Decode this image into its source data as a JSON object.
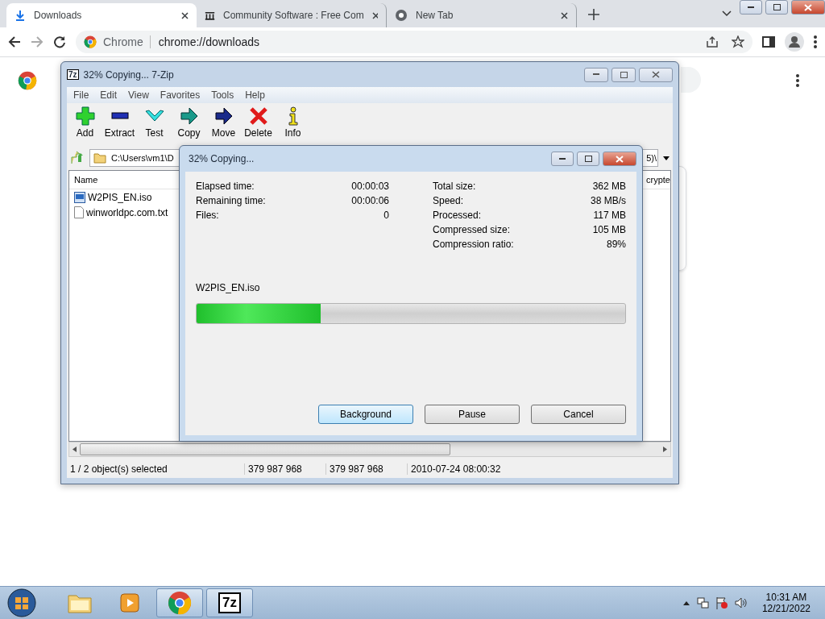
{
  "browser": {
    "tabs": [
      {
        "title": "Downloads",
        "kind": "download",
        "selected": true
      },
      {
        "title": "Community Software : Free Com",
        "kind": "archive",
        "selected": false
      },
      {
        "title": "New Tab",
        "kind": "chrome",
        "selected": false
      }
    ],
    "address": {
      "site": "Chrome",
      "url": "chrome://downloads"
    }
  },
  "zip_window": {
    "logo": "7z",
    "title": "32% Copying... 7-Zip",
    "menu": [
      "File",
      "Edit",
      "View",
      "Favorites",
      "Tools",
      "Help"
    ],
    "toolbar": [
      {
        "label": "Add",
        "kind": "add"
      },
      {
        "label": "Extract",
        "kind": "extract"
      },
      {
        "label": "Test",
        "kind": "test"
      },
      {
        "label": "Copy",
        "kind": "copy"
      },
      {
        "label": "Move",
        "kind": "move"
      },
      {
        "label": "Delete",
        "kind": "delete"
      },
      {
        "label": "Info",
        "kind": "info"
      }
    ],
    "path_start": "C:\\Users\\vm1\\D",
    "path_end": "5)\\",
    "column_name": "Name",
    "column_cut": "crypte",
    "files": [
      {
        "name": "W2PIS_EN.iso",
        "kind": "iso"
      },
      {
        "name": "winworldpc.com.txt",
        "kind": "txt"
      }
    ],
    "status": [
      "1 / 2 object(s) selected",
      "379 987 968",
      "379 987 968",
      "2010-07-24 08:00:32"
    ]
  },
  "dialog": {
    "title": "32% Copying...",
    "left_stats": [
      {
        "label": "Elapsed time:",
        "value": "00:00:03"
      },
      {
        "label": "Remaining time:",
        "value": "00:00:06"
      },
      {
        "label": "Files:",
        "value": "0"
      }
    ],
    "right_stats": [
      {
        "label": "Total size:",
        "value": "362 MB"
      },
      {
        "label": "Speed:",
        "value": "38 MB/s"
      },
      {
        "label": "Processed:",
        "value": "117 MB"
      },
      {
        "label": "Compressed size:",
        "value": "105 MB"
      },
      {
        "label": "Compression ratio:",
        "value": "89%"
      }
    ],
    "current_file": "W2PIS_EN.iso",
    "level": 0.29,
    "buttons": [
      {
        "label": "Background",
        "focused": true
      },
      {
        "label": "Pause",
        "focused": false
      },
      {
        "label": "Cancel",
        "focused": false
      }
    ]
  },
  "taskbar": {
    "apps": [
      {
        "kind": "explorer",
        "active": false
      },
      {
        "kind": "media",
        "active": false
      },
      {
        "kind": "chrome",
        "active": true
      },
      {
        "kind": "sevenzip",
        "label": "7z",
        "active": true
      }
    ],
    "time": "10:31 AM",
    "date": "12/21/2022"
  }
}
